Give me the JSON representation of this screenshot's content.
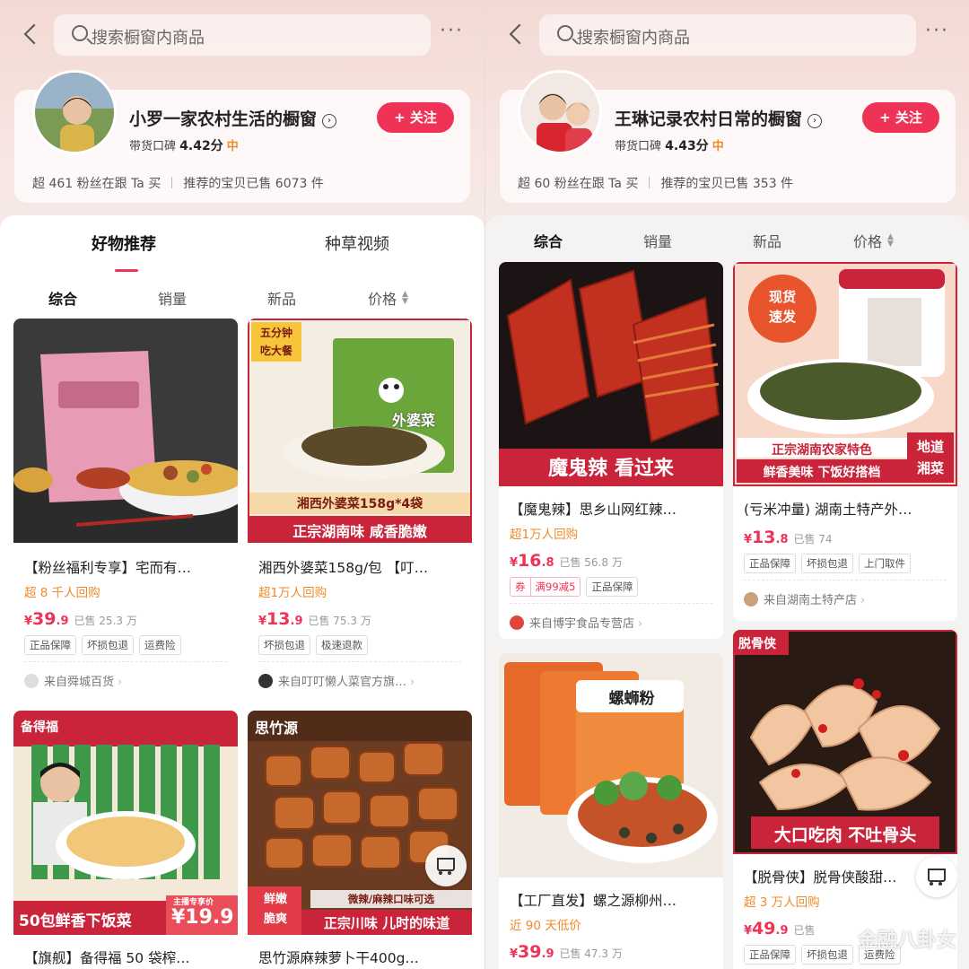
{
  "left": {
    "search_placeholder": "搜索橱窗内商品",
    "more": "···",
    "shop_name": "小罗一家农村生活的橱窗",
    "follow_label": "+ 关注",
    "rating_label": "带货口碑",
    "rating_score": "4.42分",
    "rating_level": "中",
    "stat_fans": "超 461 粉丝在跟 Ta 买",
    "stat_sold": "推荐的宝贝已售 6073 件",
    "tabs": [
      "好物推荐",
      "种草视频"
    ],
    "sorts": [
      "综合",
      "销量",
      "新品",
      "价格"
    ],
    "products": [
      {
        "title": "【粉丝福利专享】宅而有…",
        "buyers": "超 8 千人回购",
        "price_symbol": "¥",
        "price_int": "39",
        "price_dec": ".9",
        "sold": "已售 25.3 万",
        "tags": [
          "正品保障",
          "坏损包退",
          "运费险"
        ],
        "store": "来自舜城百货"
      },
      {
        "title": "湘西外婆菜158g/包 【叮…",
        "buyers": "超1万人回购",
        "price_symbol": "¥",
        "price_int": "13",
        "price_dec": ".9",
        "sold": "已售 75.3 万",
        "tags": [
          "坏损包退",
          "极速退款"
        ],
        "store": "来自叮叮懒人菜官方旗…",
        "img_badge": "五分钟\n吃大餐",
        "img_banner1": "湘西外婆菜158g*4袋",
        "img_banner2": "正宗湖南味 咸香脆嫩",
        "img_pack": "外婆菜"
      },
      {
        "title": "【旗舰】备得福 50 袋榨…",
        "img_brand": "备得福",
        "img_banner": "50包鲜香下饭菜",
        "img_price": "¥19.9",
        "img_price_tag": "主播专享价"
      },
      {
        "title": "思竹源麻辣萝卜干400g…",
        "img_brand": "思竹源",
        "img_badge": "鲜嫩\n脆爽",
        "img_sub": "微辣/麻辣口味可选",
        "img_banner": "正宗川味 儿时的味道"
      }
    ]
  },
  "right": {
    "search_placeholder": "搜索橱窗内商品",
    "more": "···",
    "shop_name": "王琳记录农村日常的橱窗",
    "follow_label": "+ 关注",
    "rating_label": "带货口碑",
    "rating_score": "4.43分",
    "rating_level": "中",
    "stat_fans": "超 60 粉丝在跟 Ta 买",
    "stat_sold": "推荐的宝贝已售 353 件",
    "sorts": [
      "综合",
      "销量",
      "新品",
      "价格"
    ],
    "products": [
      {
        "title": "【魔鬼辣】思乡山网红辣…",
        "buyers": "超1万人回购",
        "price_symbol": "¥",
        "price_int": "16",
        "price_dec": ".8",
        "sold": "已售 56.8 万",
        "tags": [
          "券",
          "满99减5",
          "正品保障"
        ],
        "store": "来自博宇食品专营店",
        "img_banner": "魔鬼辣 看过来"
      },
      {
        "title": "(亏米冲量) 湖南土特产外…",
        "price_symbol": "¥",
        "price_int": "13",
        "price_dec": ".8",
        "sold": "已售 74",
        "tags": [
          "正品保障",
          "坏损包退",
          "上门取件"
        ],
        "store": "来自湖南土特产店",
        "img_badge": "现货\n速发",
        "img_banner1": "正宗湖南农家特色",
        "img_banner2": "鲜香美味 下饭好搭档",
        "img_side": "地道\n湘菜"
      },
      {
        "title": "【工厂直发】螺之源柳州…",
        "buyers": "近 90 天低价",
        "price_symbol": "¥",
        "price_int": "39",
        "price_dec": ".9",
        "sold": "已售 47.3 万",
        "img_pack": "螺蛳粉"
      },
      {
        "title": "【脱骨侠】脱骨侠酸甜…",
        "buyers": "超 3 万人回购",
        "price_symbol": "¥",
        "price_int": "49",
        "price_dec": ".9",
        "sold": "已售",
        "tags": [
          "正品保障",
          "坏损包退",
          "运费险"
        ],
        "img_brand": "脱骨侠",
        "img_banner": "大口吃肉 不吐骨头"
      }
    ]
  },
  "watermark": "金融八卦女",
  "colors": {
    "accent": "#ef3356",
    "orange": "#f08a2a",
    "header_bg": "#f3d9d4"
  }
}
